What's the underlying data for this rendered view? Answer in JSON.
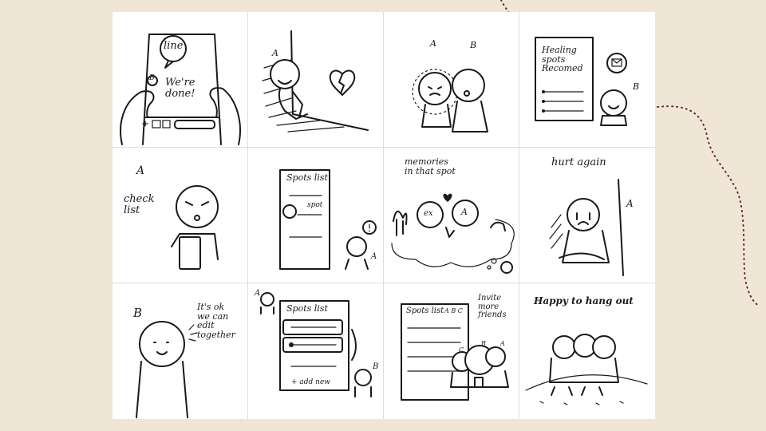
{
  "panels": [
    {
      "id": 1,
      "text": {
        "bubble": "line",
        "badge": "B",
        "message": "We're\ndone!"
      }
    },
    {
      "id": 2,
      "text": {
        "label_a": "A"
      }
    },
    {
      "id": 3,
      "text": {
        "label_a": "A",
        "label_b": "B"
      }
    },
    {
      "id": 4,
      "text": {
        "doc": "Healing\nspots\nRecomed",
        "label_b": "B"
      }
    },
    {
      "id": 5,
      "text": {
        "label_a": "A",
        "caption": "check\nlist"
      }
    },
    {
      "id": 6,
      "text": {
        "title": "Spots list",
        "item": "spot",
        "label_a": "A"
      }
    },
    {
      "id": 7,
      "text": {
        "caption": "memories\nin that spot",
        "ex": "ex",
        "label_a": "A"
      }
    },
    {
      "id": 8,
      "text": {
        "caption": "hurt again",
        "label_a": "A"
      }
    },
    {
      "id": 9,
      "text": {
        "label_b": "B",
        "caption": "It's ok\nwe can\nedit\ntogether"
      }
    },
    {
      "id": 10,
      "text": {
        "label_a": "A",
        "title": "Spots list",
        "add": "+ add new",
        "label_b": "B"
      }
    },
    {
      "id": 11,
      "text": {
        "title": "Spots list",
        "badges": "A B C",
        "caption": "Invite\nmore\nfriends",
        "label_c": "C",
        "label_b": "B",
        "label_a": "A"
      }
    },
    {
      "id": 12,
      "text": {
        "caption": "Happy to hang out"
      }
    }
  ]
}
